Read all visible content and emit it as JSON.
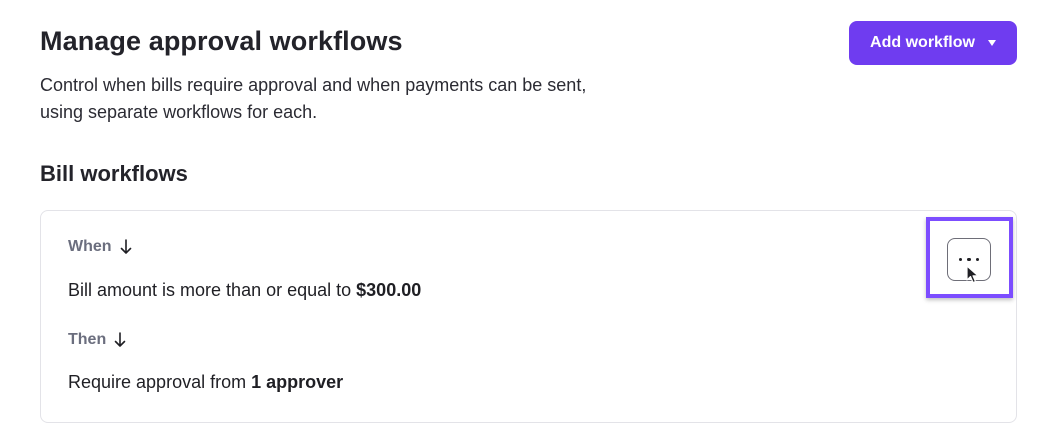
{
  "header": {
    "title": "Manage approval workflows",
    "description_line1": "Control when bills require approval and when payments can be sent,",
    "description_line2": "using separate workflows for each.",
    "add_button_label": "Add workflow"
  },
  "section": {
    "title": "Bill workflows"
  },
  "workflow": {
    "when_label": "When",
    "when_prefix": "Bill amount is more than or equal to ",
    "when_value": "$300.00",
    "then_label": "Then",
    "then_prefix": "Require approval from ",
    "then_value": "1 approver"
  },
  "icons": {
    "add_caret": "chevron-down-icon",
    "step_arrow": "arrow-down-icon",
    "more": "more-horizontal-icon",
    "cursor": "mouse-pointer-icon"
  },
  "colors": {
    "accent": "#6f3cf0",
    "highlight": "#7c4dff",
    "muted_label": "#6b6e7e"
  }
}
